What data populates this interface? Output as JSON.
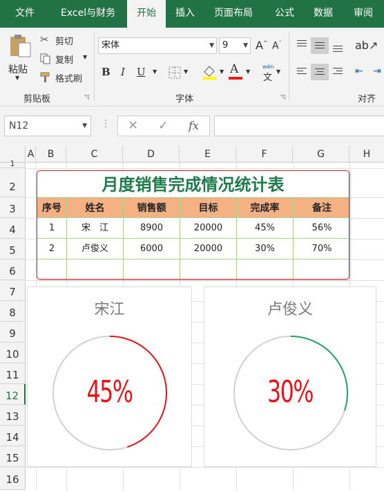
{
  "ribbon": {
    "tabs": [
      "文件",
      "Excel与财务",
      "开始",
      "插入",
      "页面布局",
      "公式",
      "数据",
      "审阅"
    ],
    "clipboard": {
      "paste": "粘贴",
      "cut": "剪切",
      "copy": "复制",
      "format_painter": "格式刷",
      "group_label": "剪贴板"
    },
    "font": {
      "name": "宋体",
      "size": "9",
      "group_label": "字体",
      "bold": "B",
      "italic": "I",
      "underline": "U",
      "font_color_letter": "A",
      "phonetic": "wén",
      "phonetic2": "文"
    },
    "alignment": {
      "group_label": "对齐方"
    }
  },
  "formula_bar": {
    "name_box": "N12",
    "cancel": "✕",
    "enter": "✓",
    "fx": "fx",
    "value": ""
  },
  "grid": {
    "columns": [
      "A",
      "B",
      "C",
      "D",
      "E",
      "F",
      "G",
      "H"
    ],
    "rows": [
      "1",
      "2",
      "3",
      "4",
      "5",
      "6",
      "7",
      "8",
      "9",
      "10",
      "11",
      "12",
      "13",
      "14",
      "15",
      "16"
    ],
    "selected_row": "12"
  },
  "table": {
    "title": "月度销售完成情况统计表",
    "headers": [
      "序号",
      "姓名",
      "销售额",
      "目标",
      "完成率",
      "备注"
    ],
    "rows": [
      [
        "1",
        "宋　江",
        "8900",
        "20000",
        "45%",
        "56%"
      ],
      [
        "2",
        "卢俊义",
        "6000",
        "20000",
        "30%",
        "70%"
      ],
      [
        "",
        "",
        "",
        "",
        "",
        ""
      ]
    ]
  },
  "chart_data": [
    {
      "type": "pie",
      "title": "宋江",
      "label": "45%",
      "value": 0.45,
      "arc_color": "#e8141b",
      "track_color": "#d0d0d0"
    },
    {
      "type": "pie",
      "title": "卢俊义",
      "label": "30%",
      "value": 0.3,
      "arc_color": "#21a366",
      "track_color": "#d0d0d0"
    }
  ],
  "colors": {
    "ribbon_green": "#217346",
    "title_green": "#1f7a4c",
    "header_fill": "#f4b183",
    "table_border": "#e02020",
    "percent_red": "#e8141b"
  }
}
